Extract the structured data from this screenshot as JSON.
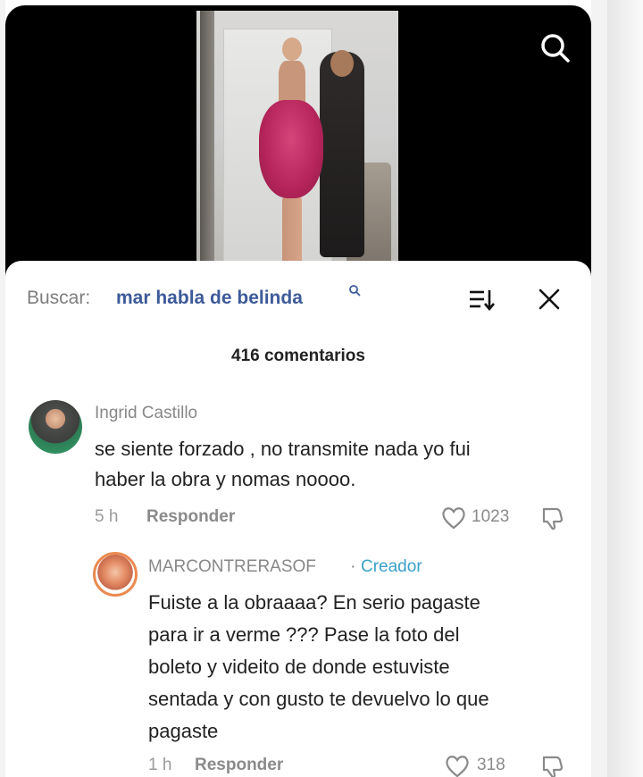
{
  "search": {
    "label": "Buscar:",
    "query": "mar habla de belinda",
    "query_suffix_icon": "search-icon"
  },
  "comments_count": "416 comentarios",
  "comments": [
    {
      "author": "Ingrid Castillo",
      "text_line1": "se siente forzado , no transmite nada yo fui",
      "text_line2": "haber la obra y nomas noooo.",
      "time": "5 h",
      "reply_label": "Responder",
      "likes": "1023"
    }
  ],
  "reply": {
    "author": "MARCONTRERASOF",
    "separator": "·",
    "badge": "Creador",
    "lines": [
      "Fuiste a la obraaaa? En serio pagaste",
      "para ir a verme ??? Pase la foto del",
      "boleto y videito de donde estuviste",
      "sentada y con gusto te devuelvo lo que",
      "pagaste"
    ],
    "time": "1 h",
    "reply_label": "Responder",
    "likes": "318"
  },
  "colors": {
    "accent_query": "#3d5a99",
    "creator_badge": "#3aa0c8",
    "muted_text": "#8a8a8a"
  }
}
